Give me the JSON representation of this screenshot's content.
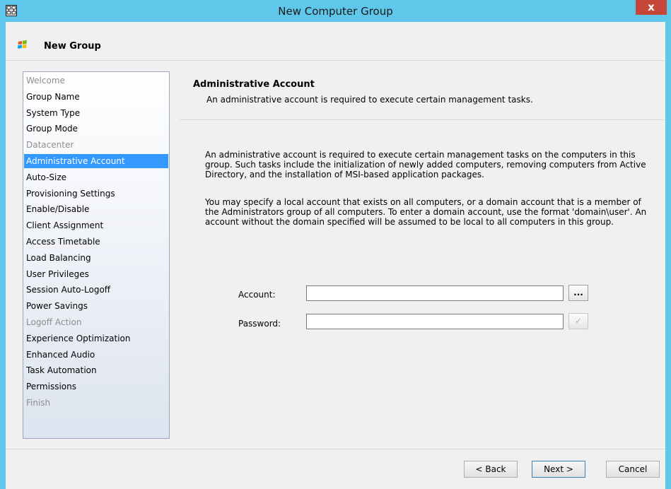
{
  "window": {
    "title": "New Computer Group",
    "close_label": "x"
  },
  "header": {
    "title": "New Group"
  },
  "nav": {
    "items": [
      {
        "label": "Welcome",
        "state": "disabled"
      },
      {
        "label": "Group Name",
        "state": "normal"
      },
      {
        "label": "System Type",
        "state": "normal"
      },
      {
        "label": "Group Mode",
        "state": "normal"
      },
      {
        "label": "Datacenter",
        "state": "disabled"
      },
      {
        "label": "Administrative Account",
        "state": "selected"
      },
      {
        "label": "Auto-Size",
        "state": "normal"
      },
      {
        "label": "Provisioning Settings",
        "state": "normal"
      },
      {
        "label": "Enable/Disable",
        "state": "normal"
      },
      {
        "label": "Client Assignment",
        "state": "normal"
      },
      {
        "label": "Access Timetable",
        "state": "normal"
      },
      {
        "label": "Load Balancing",
        "state": "normal"
      },
      {
        "label": "User Privileges",
        "state": "normal"
      },
      {
        "label": "Session Auto-Logoff",
        "state": "normal"
      },
      {
        "label": "Power Savings",
        "state": "normal"
      },
      {
        "label": "Logoff Action",
        "state": "disabled"
      },
      {
        "label": "Experience Optimization",
        "state": "normal"
      },
      {
        "label": "Enhanced Audio",
        "state": "normal"
      },
      {
        "label": "Task Automation",
        "state": "normal"
      },
      {
        "label": "Permissions",
        "state": "normal"
      },
      {
        "label": "Finish",
        "state": "disabled"
      }
    ]
  },
  "page": {
    "title": "Administrative Account",
    "subtitle": "An administrative account is required to execute certain management tasks.",
    "paragraph1": "An administrative account is required to execute certain management tasks on the computers in this group.  Such tasks include the initialization of newly added computers, removing computers from Active Directory, and the installation of MSI-based application packages.",
    "paragraph2": "You may specify a local account that exists on all computers, or a domain account that is a member of the Administrators group of all computers.  To enter a domain account, use the format 'domain\\user'.  An account without the domain specified will be assumed to be local to all computers in this group."
  },
  "form": {
    "account_label": "Account:",
    "account_value": "",
    "account_browse_label": "...",
    "password_label": "Password:",
    "password_value": "",
    "password_check_label": "✓"
  },
  "buttons": {
    "back": "< Back",
    "next": "Next >",
    "cancel": "Cancel"
  },
  "colors": {
    "title_bar": "#5ec7ea",
    "close_button": "#c7463a",
    "selection": "#3399ff"
  }
}
